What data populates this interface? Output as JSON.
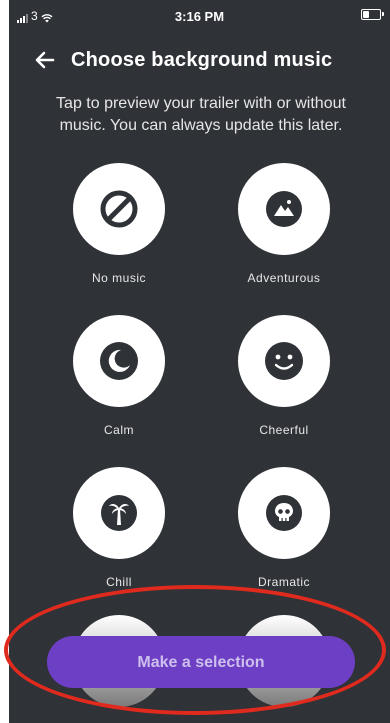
{
  "status": {
    "carrier": "3",
    "time": "3:16 PM"
  },
  "header": {
    "title": "Choose background music"
  },
  "subtitle": "Tap to preview your trailer with or without music. You can always update this later.",
  "options": [
    {
      "label": "No music",
      "icon": "no-music-icon"
    },
    {
      "label": "Adventurous",
      "icon": "mountain-icon"
    },
    {
      "label": "Calm",
      "icon": "moon-icon"
    },
    {
      "label": "Cheerful",
      "icon": "smiley-icon"
    },
    {
      "label": "Chill",
      "icon": "palm-tree-icon"
    },
    {
      "label": "Dramatic",
      "icon": "skull-icon"
    }
  ],
  "cta": {
    "label": "Make a selection"
  },
  "colors": {
    "background": "#2f3237",
    "accent": "#6d3fc4",
    "annotation": "#e02a1e"
  }
}
